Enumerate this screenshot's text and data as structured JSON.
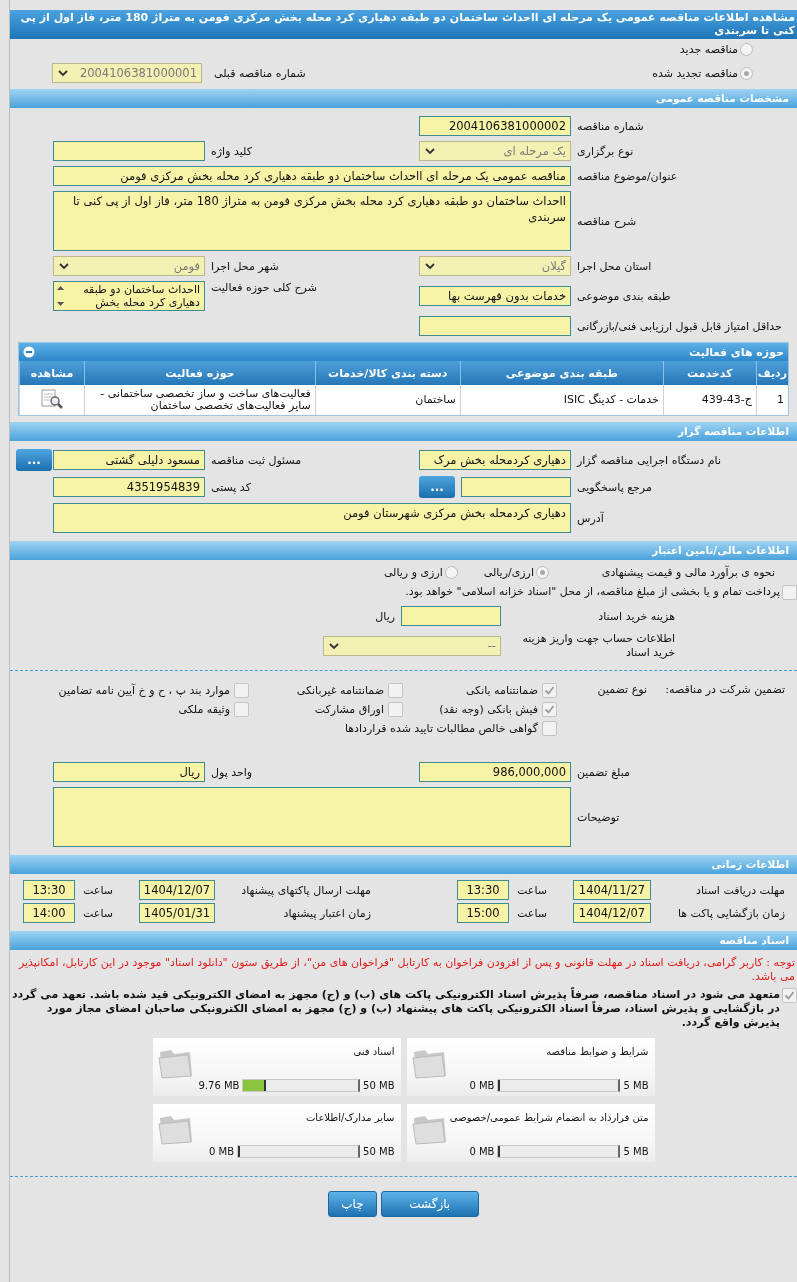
{
  "title": "مشاهده اطلاعات مناقصه عمومی یک مرحله ای ااحداث ساختمان دو طبقه دهیاری کرد محله بخش مرکزی فومن به متراژ 180 متر، فاز اول از پی کنی تا سربندی",
  "tender_type": {
    "options": [
      {
        "label": "مناقصه جدید",
        "selected": false
      },
      {
        "label": "مناقصه تجدید شده",
        "selected": true
      }
    ],
    "previous": {
      "label": "شماره مناقصه قبلی",
      "value": "2004106381000001"
    }
  },
  "general": {
    "header": "مشخصات مناقصه عمومی",
    "rows": [
      {
        "cells": [
          {
            "label": "شماره مناقصه",
            "kind": "text",
            "value": "2004106381000002"
          }
        ]
      },
      {
        "cells": [
          {
            "label": "نوع برگزاری",
            "kind": "select",
            "value": "یک مرحله ای"
          },
          {
            "label": "کلید واژه",
            "kind": "text"
          }
        ]
      },
      {
        "cells": [
          {
            "label": "عنوان/موضوع مناقصه",
            "kind": "wide",
            "value": "مناقصه عمومی یک مرحله ای ااحداث ساختمان دو طبقه دهیاری کرد محله بخش مرکزی فومن"
          }
        ]
      },
      {
        "cells": [
          {
            "label": "شرح مناقصه",
            "kind": "textarea",
            "value": "ااحداث ساختمان دو طبقه دهیاری کرد محله بخش مرکزی فومن به متراژ 180 متر، فاز اول از پی کنی تا سربندی"
          }
        ]
      },
      {
        "cells": [
          {
            "label": "استان محل اجرا",
            "kind": "select",
            "value": "گیلان"
          },
          {
            "label": "شهر محل اجرا",
            "kind": "select",
            "value": "فومن"
          }
        ]
      },
      {
        "cells": [
          {
            "label": "طبقه بندی موضوعی",
            "kind": "text",
            "value": "خدمات بدون فهرست بها"
          },
          {
            "label": "شرح کلی حوزه فعالیت",
            "kind": "listbox",
            "value": "ااحداث ساختمان دو طبقه دهیاری کرد محله بخش"
          }
        ]
      },
      {
        "cells": [
          {
            "label": "حداقل امتیاز قابل قبول ارزیابی فنی/بازرگانی",
            "kind": "text"
          }
        ]
      }
    ]
  },
  "activities": {
    "header": "حوزه های فعالیت",
    "columns": [
      "ردیف",
      "کدخدمت",
      "طبقه بندی موضوعی",
      "دسته بندی کالا/خدمات",
      "حوزه فعالیت",
      "مشاهده"
    ],
    "rows": [
      {
        "cells": [
          "1",
          "ج-43-439",
          "خدمات - کدینگ ISIC",
          "ساختمان",
          "فعالیت‌های ساخت و ساز تخصصی ساختمانی - سایر فعالیت‌های تخصصی ساختمان"
        ]
      }
    ]
  },
  "organizer": {
    "header": "اطلاعات مناقصه گزار",
    "rows": [
      {
        "cells": [
          {
            "label": "نام دستگاه اجرایی مناقصه گزار",
            "kind": "text",
            "value": "دهیاری کردمحله بخش مرک"
          },
          {
            "label": "مسئول ثبت مناقصه",
            "kind": "text",
            "value": "مسعود دلیلی گشتی",
            "button": "..."
          }
        ]
      },
      {
        "cells": [
          {
            "label": "مرجع پاسخگویی",
            "kind": "text",
            "button": "..."
          },
          {
            "label": "کد پستی",
            "kind": "text",
            "value": "4351954839"
          }
        ]
      },
      {
        "cells": [
          {
            "label": "آدرس",
            "kind": "address",
            "value": "دهیاری کردمحله بخش مرکزی شهرستان فومن"
          }
        ]
      }
    ]
  },
  "finance": {
    "header": "اطلاعات مالی/تامین اعتبار",
    "estimate": {
      "label": "نحوه ی برآورد مالی و قیمت پیشنهادی",
      "options": [
        {
          "label": "ارزی/ریالی",
          "selected": true
        },
        {
          "label": "ارزی و ریالی",
          "selected": false
        }
      ]
    },
    "treasury": {
      "label": "پرداخت تمام و یا بخشی از مبلغ مناقصه، از محل \"اسناد خزانه اسلامی\" خواهد بود.",
      "checked": false
    },
    "fee": {
      "label": "هزینه خرید اسناد",
      "unit": "ریال"
    },
    "account": {
      "label": "اطلاعات حساب جهت واریز هزینه خرید اسناد",
      "value": "--"
    }
  },
  "guarantee": {
    "label": "تضمین شرکت در مناقصه:",
    "type_label": "نوع تضمین",
    "options": [
      {
        "label": "ضمانتنامه بانکی",
        "checked": true
      },
      {
        "label": "ضمانتنامه غیربانکی",
        "checked": false
      },
      {
        "label": "موارد بند پ ، ح و خ آیین نامه تضامین",
        "checked": false
      },
      {
        "label": "فیش بانکی (وجه نقد)",
        "checked": true
      },
      {
        "label": "اوراق مشارکت",
        "checked": false
      },
      {
        "label": "وثیقه ملکی",
        "checked": false
      },
      {
        "label": "گواهی خالص مطالبات تایید شده قراردادها",
        "checked": false
      }
    ],
    "rows": [
      {
        "cells": [
          {
            "label": "مبلغ تضمین",
            "kind": "text",
            "value": "986,000,000"
          },
          {
            "label": "واحد پول",
            "kind": "text",
            "value": "ریال"
          }
        ]
      },
      {
        "cells": [
          {
            "label": "توضیحات",
            "kind": "textarea"
          }
        ]
      }
    ]
  },
  "timing": {
    "header": "اطلاعات زمانی",
    "items": [
      {
        "label": "مهلت دریافت اسناد",
        "date": "1404/11/27",
        "time_label": "ساعت",
        "time": "13:30"
      },
      {
        "label": "مهلت ارسال پاکتهای پیشنهاد",
        "date": "1404/12/07",
        "time_label": "ساعت",
        "time": "13:30"
      },
      {
        "label": "زمان بازگشایی پاکت ها",
        "date": "1404/12/07",
        "time_label": "ساعت",
        "time": "15:00"
      },
      {
        "label": "زمان اعتبار پیشنهاد",
        "date": "1405/01/31",
        "time_label": "ساعت",
        "time": "14:00"
      }
    ]
  },
  "documents": {
    "header": "اسناد مناقصه",
    "notice": "توجه : کاربر گرامی، دریافت اسناد در مهلت قانونی و پس از افزودن فراخوان به کارتابل \"فراخوان های من\"، از طریق ستون \"دانلود اسناد\" موجود در این کارتابل، امکانپذیر می باشد.",
    "commitment": {
      "label": "متعهد می شود در اسناد مناقصه، صرفاً پذیرش اسناد الکترونیکی پاکت های (ب) و (ج) مجهز به امضای الکترونیکی قید شده باشد. تعهد می گردد در بازگشایی و پذیرش اسناد، صرفاً اسناد الکترونیکی پاکت های پیشنهاد (ب) و (ج) مجهز به امضای الکترونیکی صاحبان امضای مجاز مورد پذیرش واقع گردد.",
      "checked": true
    },
    "files": [
      {
        "name": "شرایط و ضوابط مناقصه",
        "size": "0 MB",
        "max": "5 MB",
        "level": 0
      },
      {
        "name": "اسناد فنی",
        "size": "9.76 MB",
        "max": "50 MB",
        "level": 0.195
      },
      {
        "name": "متن قرارداد به انضمام شرایط عمومی/خصوصی",
        "size": "0 MB",
        "max": "5 MB",
        "level": 0
      },
      {
        "name": "سایر مدارک/اطلاعات",
        "size": "0 MB",
        "max": "50 MB",
        "level": 0
      }
    ]
  },
  "buttons": [
    "بازگشت",
    "چاپ"
  ]
}
